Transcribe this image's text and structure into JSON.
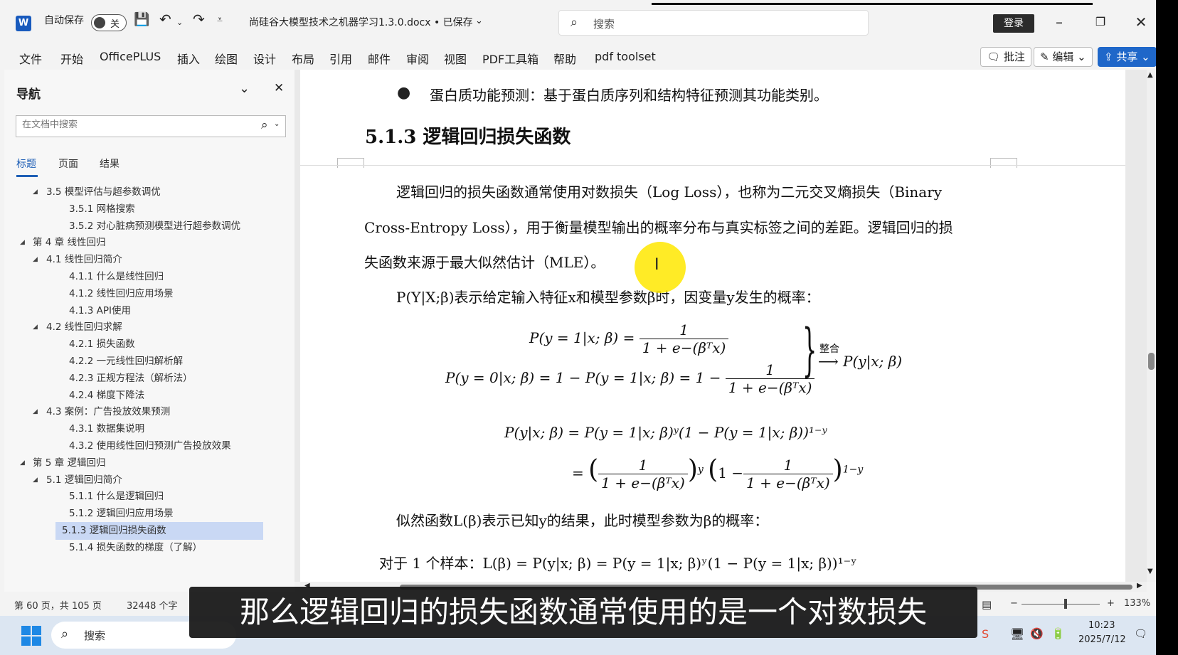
{
  "titlebar": {
    "app_icon": "W",
    "autosave_label": "自动保存",
    "autosave_state": "关",
    "doc_title": "尚硅谷大模型技术之机器学习1.3.0.docx • 已保存",
    "search_placeholder": "搜索",
    "login_label": "登录"
  },
  "ribbon": {
    "tabs": [
      "文件",
      "开始",
      "OfficePLUS",
      "插入",
      "绘图",
      "设计",
      "布局",
      "引用",
      "邮件",
      "审阅",
      "视图",
      "PDF工具箱",
      "帮助",
      "pdf toolset"
    ],
    "comment_label": "批注",
    "edit_label": "编辑",
    "share_label": "共享"
  },
  "nav": {
    "title": "导航",
    "search_placeholder": "在文档中搜索",
    "tabs": [
      "标题",
      "页面",
      "结果"
    ],
    "items": [
      {
        "label": "3.5 模型评估与超参数调优",
        "level": 2,
        "caret": true
      },
      {
        "label": "3.5.1 网格搜索",
        "level": 3,
        "caret": false
      },
      {
        "label": "3.5.2 对心脏病预测模型进行超参数调优",
        "level": 3,
        "caret": false
      },
      {
        "label": "第 4 章 线性回归",
        "level": 1,
        "caret": true
      },
      {
        "label": "4.1 线性回归简介",
        "level": 2,
        "caret": true
      },
      {
        "label": "4.1.1 什么是线性回归",
        "level": 3,
        "caret": false
      },
      {
        "label": "4.1.2 线性回归应用场景",
        "level": 3,
        "caret": false
      },
      {
        "label": "4.1.3 API使用",
        "level": 3,
        "caret": false
      },
      {
        "label": "4.2 线性回归求解",
        "level": 2,
        "caret": true
      },
      {
        "label": "4.2.1 损失函数",
        "level": 3,
        "caret": false
      },
      {
        "label": "4.2.2 一元线性回归解析解",
        "level": 3,
        "caret": false
      },
      {
        "label": "4.2.3 正规方程法（解析法）",
        "level": 3,
        "caret": false
      },
      {
        "label": "4.2.4 梯度下降法",
        "level": 3,
        "caret": false
      },
      {
        "label": "4.3 案例：广告投放效果预测",
        "level": 2,
        "caret": true
      },
      {
        "label": "4.3.1 数据集说明",
        "level": 3,
        "caret": false
      },
      {
        "label": "4.3.2 使用线性回归预测广告投放效果",
        "level": 3,
        "caret": false
      },
      {
        "label": "第 5 章 逻辑回归",
        "level": 1,
        "caret": true
      },
      {
        "label": "5.1 逻辑回归简介",
        "level": 2,
        "caret": true
      },
      {
        "label": "5.1.1 什么是逻辑回归",
        "level": 3,
        "caret": false
      },
      {
        "label": "5.1.2 逻辑回归应用场景",
        "level": 3,
        "caret": false
      },
      {
        "label": "5.1.3 逻辑回归损失函数",
        "level": 3,
        "caret": false,
        "selected": true
      },
      {
        "label": "5.1.4 损失函数的梯度（了解）",
        "level": 3,
        "caret": false
      }
    ]
  },
  "doc": {
    "bullet_text": "蛋白质功能预测：基于蛋白质序列和结构特征预测其功能类别。",
    "heading": "5.1.3 逻辑回归损失函数",
    "para1_line1": "逻辑回归的损失函数通常使用对数损失（Log Loss），也称为二元交叉熵损失（Binary",
    "para1_line2": "Cross-Entropy Loss），用于衡量模型输出的概率分布与真实标签之间的差距。逻辑回归的损",
    "para1_line3": "失函数来源于最大似然估计（MLE）。",
    "para2": "P(Y|X;β)表示给定输入特征x和模型参数β时，因变量y发生的概率：",
    "eq1_lhs": "P(y = 1|x; β) =",
    "eq2_lhs": "P(y = 0|x; β) = 1 − P(y = 1|x; β) = 1 −",
    "frac_num": "1",
    "frac_den": "1 + e−(βᵀx)",
    "combine_label": "整合",
    "combine_result": "⟶ P(y|x; β)",
    "eq3": "P(y|x; β) = P(y = 1|x; β)ʸ(1 − P(y = 1|x; β))¹⁻ʸ",
    "eq4_prefix": "=",
    "eq4_exp1": "y",
    "eq4_exp2": "1−y",
    "para3": "似然函数L(β)表示已知y的结果，此时模型参数为β的概率：",
    "para4": "对于 1 个样本：L(β) = P(y|x; β) = P(y = 1|x; β)ʸ(1 − P(y = 1|x; β))¹⁻ʸ"
  },
  "statusbar": {
    "page_info": "第 60 页，共 105 页",
    "word_count": "32448 个字",
    "zoom": "133%"
  },
  "taskbar": {
    "search_placeholder": "搜索",
    "time": "10:23",
    "date": "2025/7/12"
  },
  "subtitle": "那么逻辑回归的损失函数通常使用的是一个对数损失",
  "colors": {
    "accent": "#1f67c9",
    "selected_nav": "#c9d8f4",
    "cursor_highlight": "#ffe800"
  }
}
